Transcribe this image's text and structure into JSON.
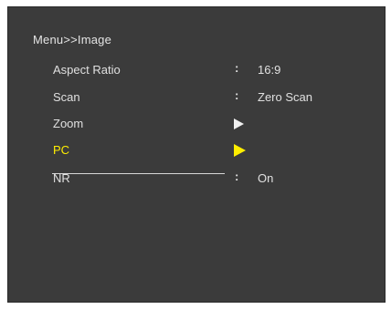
{
  "menu": {
    "breadcrumb": "Menu>>Image",
    "items": [
      {
        "label": "Aspect Ratio",
        "separator": ":",
        "value": "16:9",
        "control": "value"
      },
      {
        "label": "Scan",
        "separator": ":",
        "value": "Zero Scan",
        "control": "value"
      },
      {
        "label": "Zoom",
        "control": "arrow",
        "arrow_icon": "right-triangle-icon"
      },
      {
        "label": "PC",
        "control": "arrow",
        "arrow_icon": "right-triangle-icon",
        "selected": true
      },
      {
        "label": "NR",
        "separator": ":",
        "value": "On",
        "control": "value"
      }
    ]
  },
  "colors": {
    "background": "#3b3b3b",
    "text": "#e0e0e0",
    "highlight": "#ffee00"
  }
}
